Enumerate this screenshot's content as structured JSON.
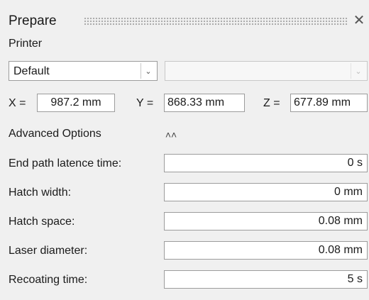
{
  "panel": {
    "title": "Prepare",
    "close_icon": "close-icon",
    "printer_label": "Printer",
    "printer_select": {
      "value": "Default"
    },
    "secondary_select": {
      "value": ""
    },
    "coords": {
      "x_label": "X =",
      "x_value": "987.2 mm",
      "y_label": "Y =",
      "y_value": "868.33 mm",
      "z_label": "Z =",
      "z_value": "677.89 mm"
    },
    "advanced": {
      "label": "Advanced Options",
      "toggle_icon": "chevron-double-up-icon",
      "fields": [
        {
          "label": "End path latence time:",
          "value": "0 s"
        },
        {
          "label": "Hatch width:",
          "value": "0 mm"
        },
        {
          "label": "Hatch space:",
          "value": "0.08 mm"
        },
        {
          "label": "Laser diameter:",
          "value": "0.08 mm"
        },
        {
          "label": "Recoating time:",
          "value": "5 s"
        }
      ]
    }
  }
}
